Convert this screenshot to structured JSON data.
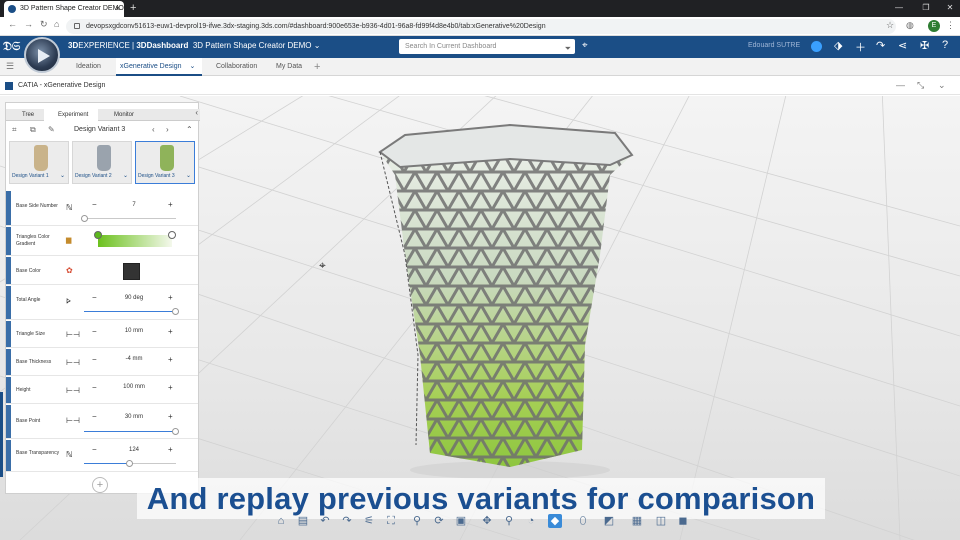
{
  "browser": {
    "tab_title": "3D Pattern Shape Creator DEMO",
    "tab_close": "×",
    "new_tab": "+",
    "url": "devopsxgdconv51613-euw1-devprol19-ifwe.3dx-staging.3ds.com/#dashboard:900e653e-b936-4d01-96a8-fd99f4d8e4b0/tab:xGenerative%20Design",
    "profile_initial": "E",
    "window_controls": [
      "—",
      "❐",
      "✕"
    ]
  },
  "header": {
    "brand_prefix": "3D",
    "brand_experience": "EXPERIENCE",
    "brand_separator": " | ",
    "brand_dashboard": "3DDashboard",
    "dashboard_title": "3D Pattern Shape Creator DEMO",
    "search_placeholder": "Search In Current Dashboard",
    "user_name": "Edouard SUTRE"
  },
  "tabs": [
    {
      "label": "Ideation"
    },
    {
      "label": "xGenerative Design",
      "active": true
    },
    {
      "label": "Collaboration"
    },
    {
      "label": "My Data"
    }
  ],
  "tab_add": "+",
  "app": {
    "title": "CATIA - xGenerative Design"
  },
  "panel": {
    "tabs": [
      "Tree",
      "Experiment",
      "Monitor"
    ],
    "variant_name": "Design Variant 3",
    "variants": [
      {
        "label": "Design Variant 1",
        "color": "#c9b38a"
      },
      {
        "label": "Design Variant 2",
        "color": "#9aa3ad"
      },
      {
        "label": "Design Variant 3",
        "color": "#8fb35a",
        "selected": true
      }
    ],
    "parameters": [
      {
        "label": "Base Side Number",
        "value": "7",
        "slider": 0.0
      },
      {
        "label": "Triangles Color Gradient"
      },
      {
        "label": "Base Color",
        "color": "#333333"
      },
      {
        "label": "Total Angle",
        "value": "90 deg",
        "slider": 1.0
      },
      {
        "label": "Triangle Size",
        "value": "10 mm"
      },
      {
        "label": "Base Thickness",
        "value": "-4 mm"
      },
      {
        "label": "Height",
        "value": "100 mm"
      },
      {
        "label": "Base Point",
        "value": "30 mm",
        "slider": 1.0
      },
      {
        "label": "Base Transparency",
        "value": "124",
        "slider": 0.49
      }
    ],
    "minus": "−",
    "plus": "+",
    "add": "+"
  },
  "caption": "And replay previous variants for comparison",
  "colors": {
    "brand_blue": "#1b4e86",
    "vase_green": "#8ec63f",
    "caption_blue": "#1b4f91"
  }
}
